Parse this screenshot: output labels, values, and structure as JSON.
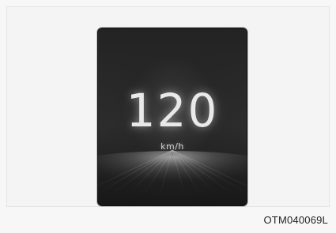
{
  "display": {
    "speed": "120",
    "unit": "km/h"
  },
  "figure": {
    "code": "OTM040069L"
  },
  "colors": {
    "page_background": "#f7f7f7",
    "display_background": "#232323",
    "speed_text": "#e9e9e9"
  }
}
